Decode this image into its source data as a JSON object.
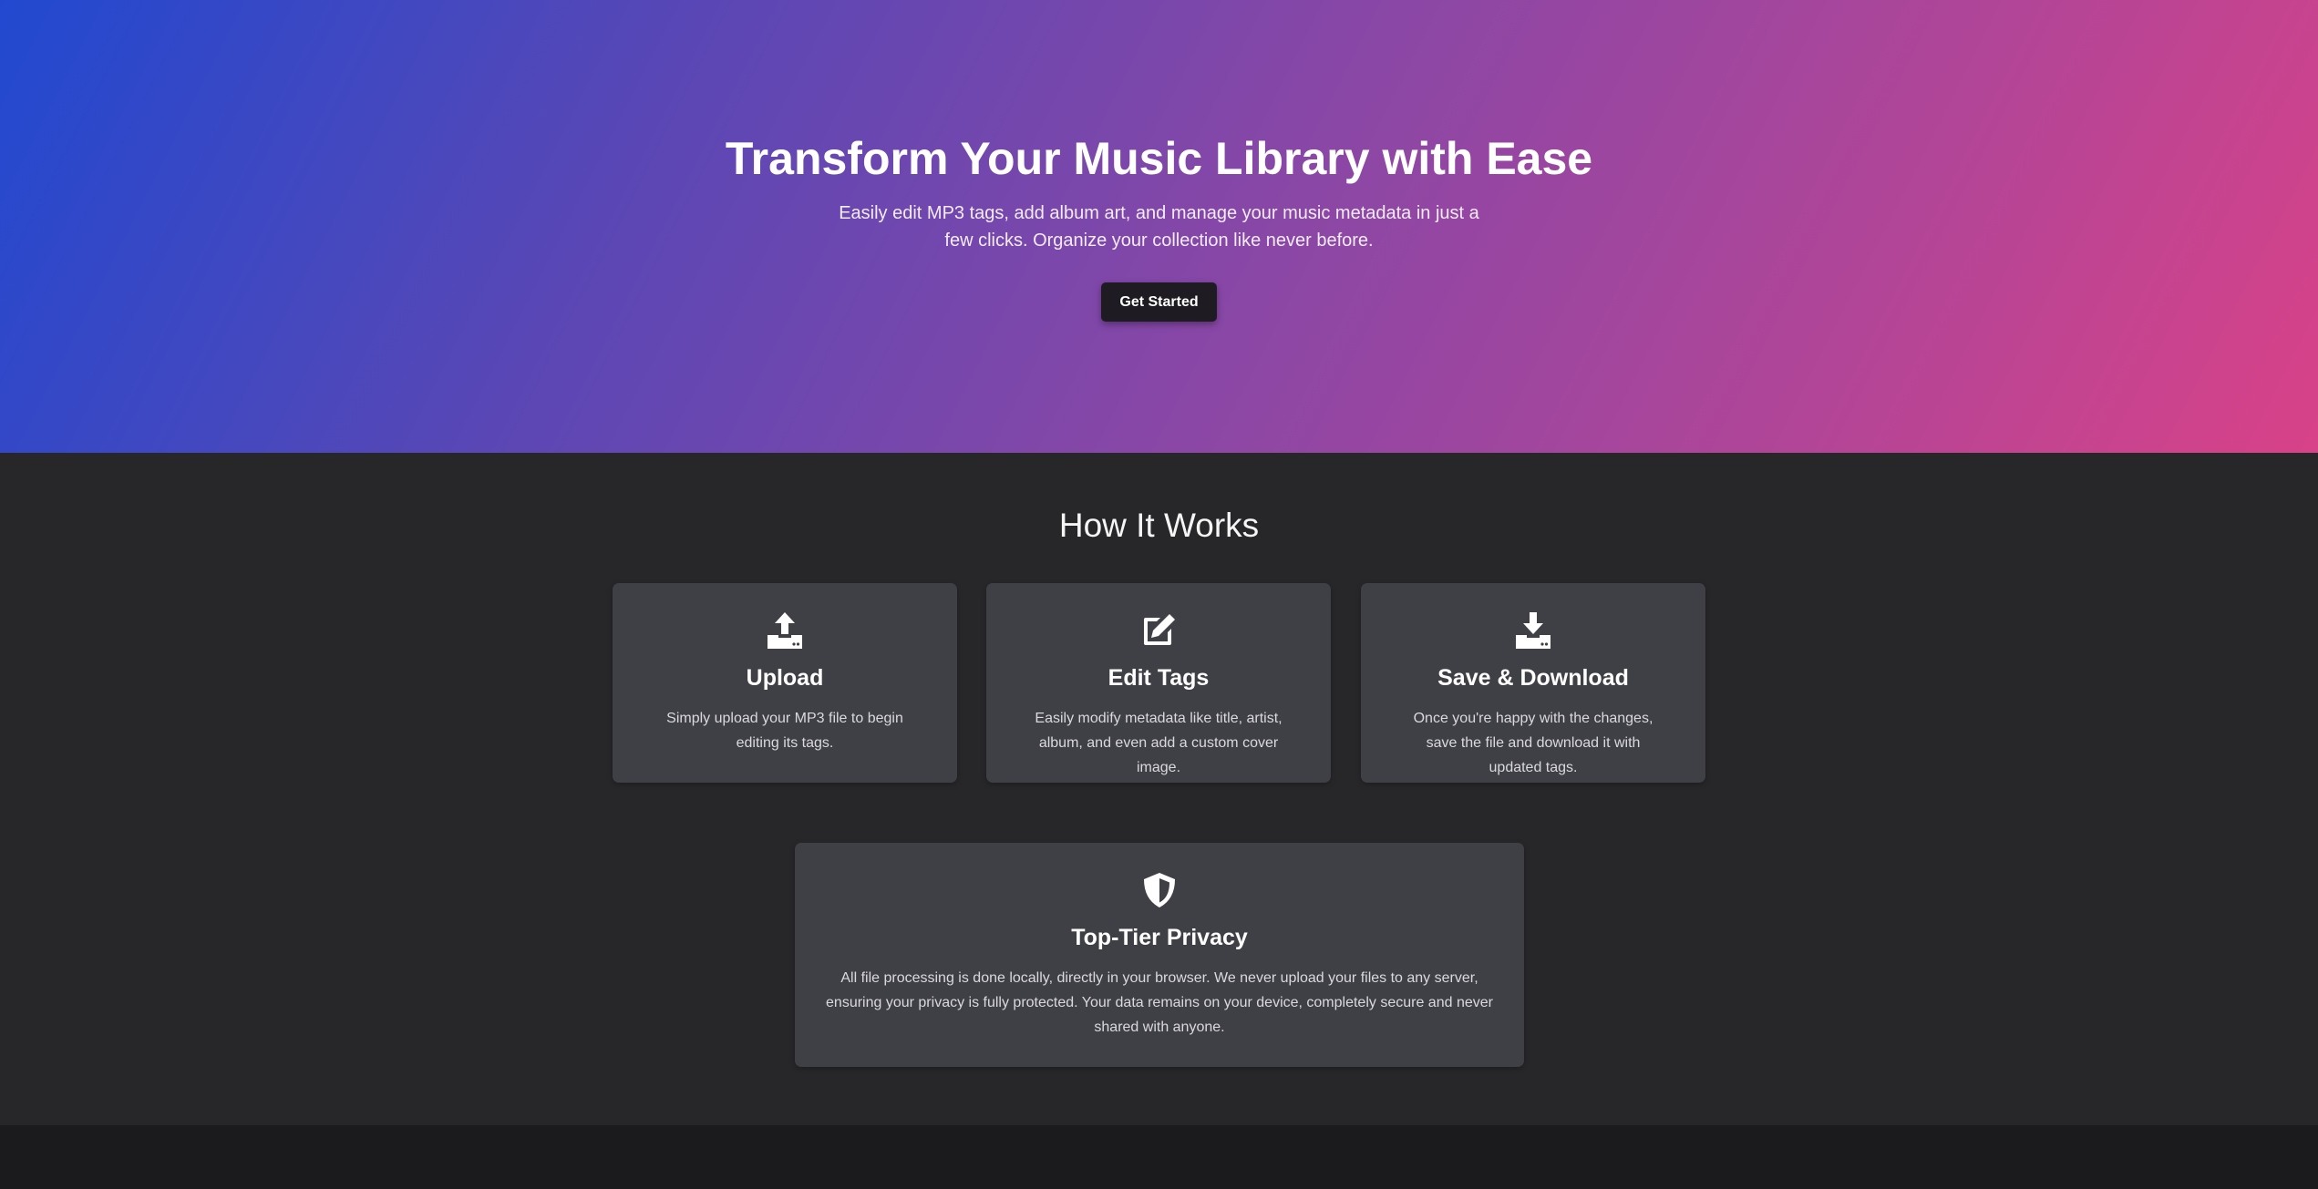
{
  "hero": {
    "title": "Transform Your Music Library with Ease",
    "subtitle": "Easily edit MP3 tags, add album art, and manage your music metadata in just a few clicks. Organize your collection like never before.",
    "cta_label": "Get Started"
  },
  "how_it_works": {
    "title": "How It Works",
    "steps": [
      {
        "icon": "upload-icon",
        "title": "Upload",
        "description": "Simply upload your MP3 file to begin editing its tags."
      },
      {
        "icon": "edit-icon",
        "title": "Edit Tags",
        "description": "Easily modify metadata like title, artist, album, and even add a custom cover image."
      },
      {
        "icon": "download-icon",
        "title": "Save & Download",
        "description": "Once you're happy with the changes, save the file and download it with updated tags."
      }
    ],
    "privacy": {
      "icon": "shield-icon",
      "title": "Top-Tier Privacy",
      "description": "All file processing is done locally, directly in your browser. We never upload your files to any server, ensuring your privacy is fully protected. Your data remains on your device, completely secure and never shared with anyone."
    }
  },
  "colors": {
    "hero_gradient_start": "#2149d0",
    "hero_gradient_end": "#d84288",
    "section_background": "#27272a",
    "card_background": "#3f3f46",
    "button_background": "#1e1c22",
    "footer_background": "#1b1b1d"
  }
}
